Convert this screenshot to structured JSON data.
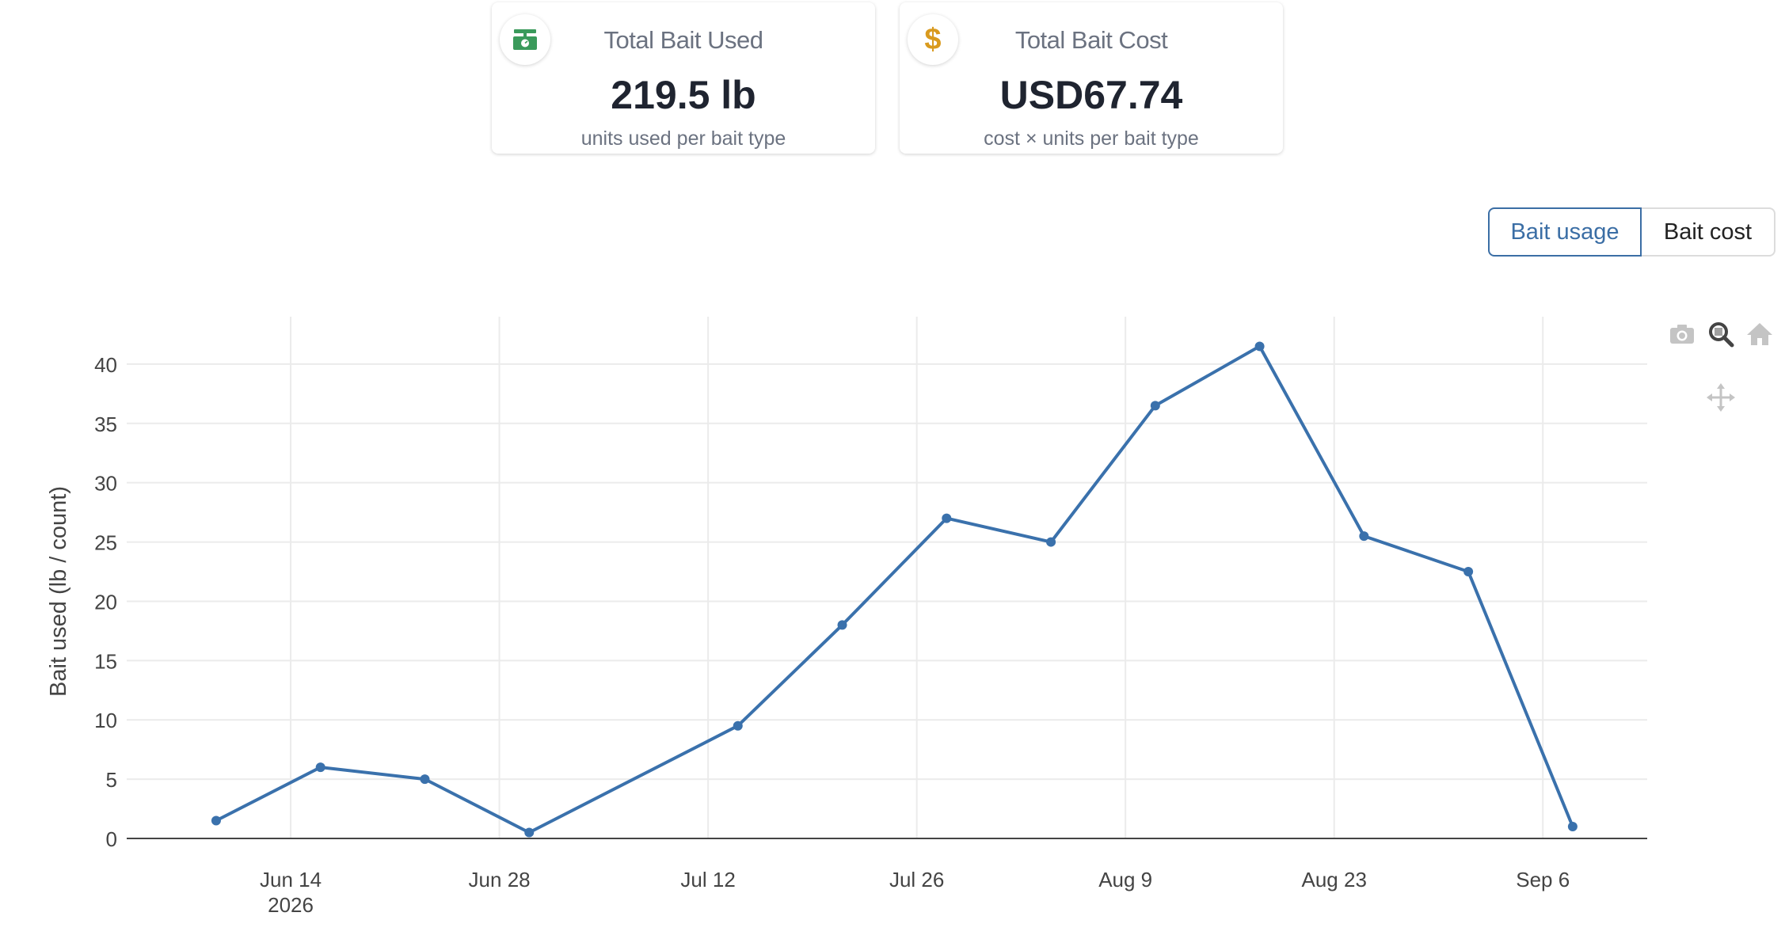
{
  "cards": [
    {
      "title": "Total Bait Used",
      "value": "219.5 lb",
      "sub": "units used per bait type",
      "icon": "scale-icon",
      "icon_color": "#3a9a5b"
    },
    {
      "title": "Total Bait Cost",
      "value": "USD67.74",
      "sub": "cost × units per bait type",
      "icon": "dollar-icon",
      "icon_color": "#d99a1e"
    }
  ],
  "toggle": {
    "usage_label": "Bait usage",
    "cost_label": "Bait cost",
    "active": "usage"
  },
  "colors": {
    "line": "#3a71ac",
    "active_border": "#3b6ea5"
  },
  "modebar": [
    "camera-icon",
    "zoom-icon",
    "home-icon",
    "pan-icon"
  ],
  "chart_data": {
    "type": "line",
    "title": "",
    "xlabel": "",
    "ylabel": "Bait used (lb / count)",
    "x": [
      "2026-06-09",
      "2026-06-16",
      "2026-06-23",
      "2026-06-30",
      "2026-07-14",
      "2026-07-21",
      "2026-07-28",
      "2026-08-04",
      "2026-08-11",
      "2026-08-18",
      "2026-08-25",
      "2026-09-01",
      "2026-09-08"
    ],
    "series": [
      {
        "values": [
          1.5,
          6,
          5,
          0.5,
          9.5,
          18,
          27,
          25,
          36.5,
          41.5,
          25.5,
          22.5,
          1
        ]
      }
    ],
    "xticks": [
      "Jun 14\n2026",
      "Jun 28",
      "Jul 12",
      "Jul 26",
      "Aug 9",
      "Aug 23",
      "Sep 6"
    ],
    "xtick_dates": [
      "2026-06-14",
      "2026-06-28",
      "2026-07-12",
      "2026-07-26",
      "2026-08-09",
      "2026-08-23",
      "2026-09-06"
    ],
    "xlim": [
      "2026-06-03",
      "2026-09-13"
    ],
    "yticks": [
      0,
      5,
      10,
      15,
      20,
      25,
      30,
      35,
      40
    ],
    "ylim": [
      0,
      44
    ],
    "grid": true,
    "legend": "none"
  }
}
